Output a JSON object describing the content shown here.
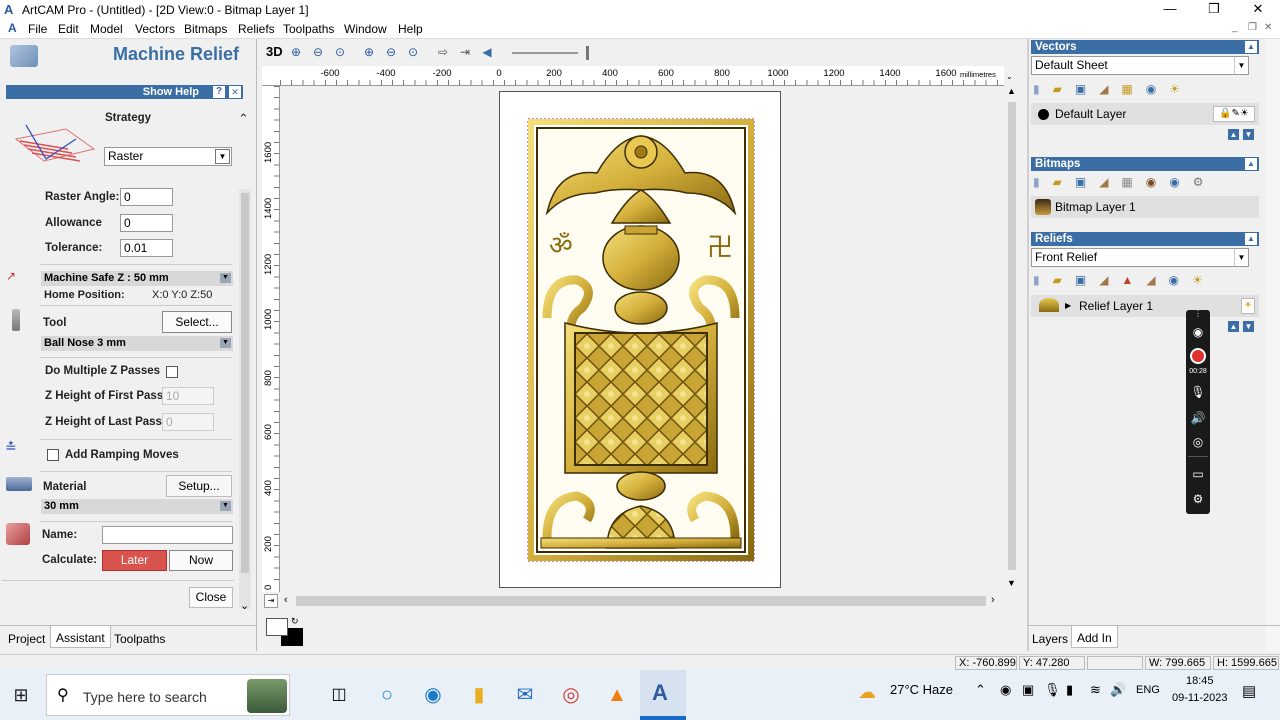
{
  "window": {
    "title": "ArtCAM Pro - (Untitled) - [2D View:0 - Bitmap Layer 1]",
    "minimize": "—",
    "restore": "❐",
    "close": "✕",
    "inner_min": "_",
    "inner_restore": "❐",
    "inner_close": "✕"
  },
  "menu": [
    "File",
    "Edit",
    "Model",
    "Vectors",
    "Bitmaps",
    "Reliefs",
    "Toolpaths",
    "Window",
    "Help"
  ],
  "left": {
    "title": "Machine Relief",
    "show_help": "Show Help",
    "help_q": "?",
    "help_x": "✕",
    "strategy_label": "Strategy",
    "strategy_value": "Raster",
    "raster_angle_label": "Raster Angle:",
    "raster_angle": "0",
    "allowance_label": "Allowance",
    "allowance": "0",
    "tolerance_label": "Tolerance:",
    "tolerance": "0.01",
    "safe_z": "Machine Safe Z : 50 mm",
    "home_label": "Home Position:",
    "home_value": "X:0 Y:0 Z:50",
    "tool_label": "Tool",
    "tool_select": "Select...",
    "tool_value": "Ball Nose 3 mm",
    "multi_z": "Do Multiple Z Passes",
    "first_pass_label": "Z Height of First Pass",
    "first_pass": "10",
    "last_pass_label": "Z Height of Last Pass",
    "last_pass": "0",
    "ramping": "Add Ramping Moves",
    "material_label": "Material",
    "material_setup": "Setup...",
    "material_value": "30 mm",
    "name_label": "Name:",
    "name_value": "",
    "calc_label": "Calculate:",
    "later": "Later",
    "now": "Now",
    "close": "Close",
    "tabs": [
      "Project",
      "Assistant",
      "Toolpaths"
    ]
  },
  "toolbar": {
    "view3d": "3D"
  },
  "ruler": {
    "h": [
      "-600",
      "-400",
      "-200",
      "0",
      "200",
      "400",
      "600",
      "800",
      "1000",
      "1200",
      "1400",
      "1600"
    ],
    "h_unit": "millimetres",
    "v": [
      "1600",
      "1400",
      "1200",
      "1000",
      "800",
      "600",
      "400",
      "200",
      "0"
    ]
  },
  "right": {
    "vectors_title": "Vectors",
    "vectors_sheet": "Default Sheet",
    "vectors_layer": "Default Layer",
    "bitmaps_title": "Bitmaps",
    "bitmap_layer": "Bitmap Layer 1",
    "reliefs_title": "Reliefs",
    "relief_combo": "Front Relief",
    "relief_layer": "Relief Layer 1",
    "tabs": [
      "Layers",
      "Add In"
    ]
  },
  "status": {
    "x": "X: -760.899",
    "y": "Y: 47.280",
    "w": "W: 799.665",
    "h": "H: 1599.665"
  },
  "recorder": {
    "time": "00:28"
  },
  "taskbar": {
    "search_placeholder": "Type here to search",
    "weather": "27°C  Haze",
    "lang": "ENG",
    "time": "18:45",
    "date": "09-11-2023"
  },
  "colors": {
    "accent": "#3a6ea5",
    "later_btn": "#d9534f",
    "relief_gold": "#d8b640"
  }
}
